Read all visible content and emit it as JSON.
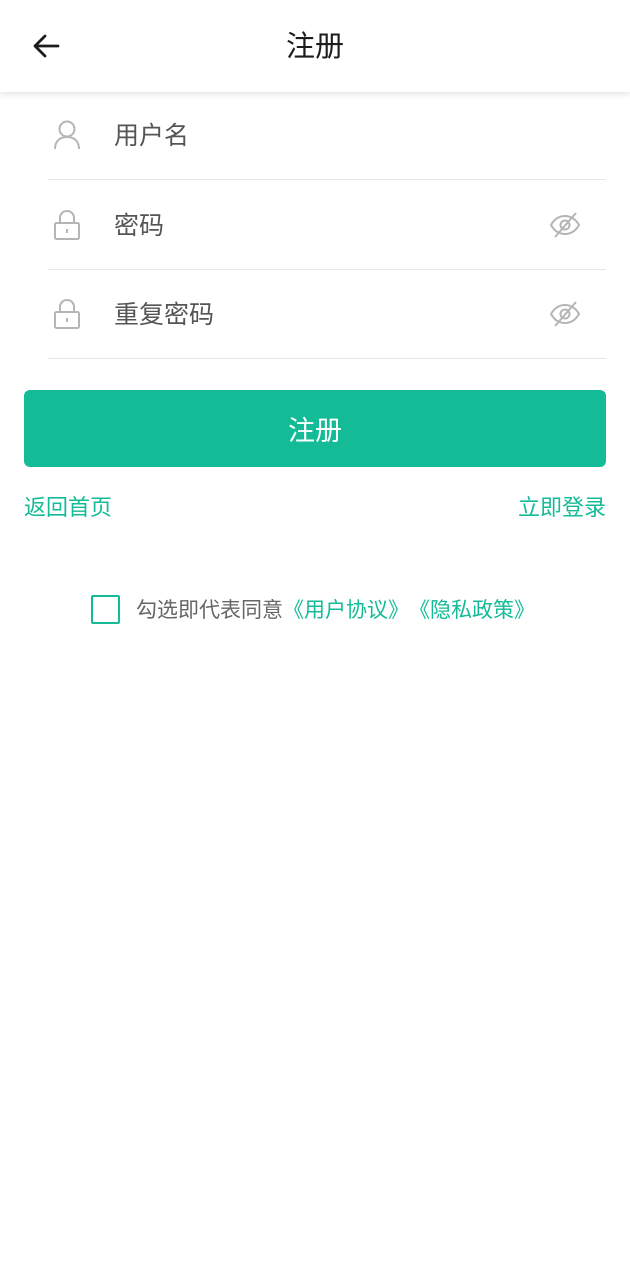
{
  "header": {
    "title": "注册",
    "back_icon": "arrow-left-icon"
  },
  "form": {
    "username": {
      "placeholder": "用户名",
      "value": "",
      "icon": "user-icon"
    },
    "password": {
      "placeholder": "密码",
      "value": "",
      "icon": "lock-icon",
      "toggle_icon": "eye-off-icon"
    },
    "repeat_password": {
      "placeholder": "重复密码",
      "value": "",
      "icon": "lock-icon",
      "toggle_icon": "eye-off-icon"
    },
    "submit_label": "注册"
  },
  "links": {
    "home": "返回首页",
    "login": "立即登录"
  },
  "agreement": {
    "checked": false,
    "prefix": "勾选即代表同意",
    "user_agreement": "《用户协议》",
    "privacy_policy": "《隐私政策》"
  },
  "colors": {
    "accent": "#14bb97",
    "text": "#1c1c1c",
    "muted": "#666666",
    "icon": "#b5b5b5",
    "divider": "#e6e6e6"
  }
}
